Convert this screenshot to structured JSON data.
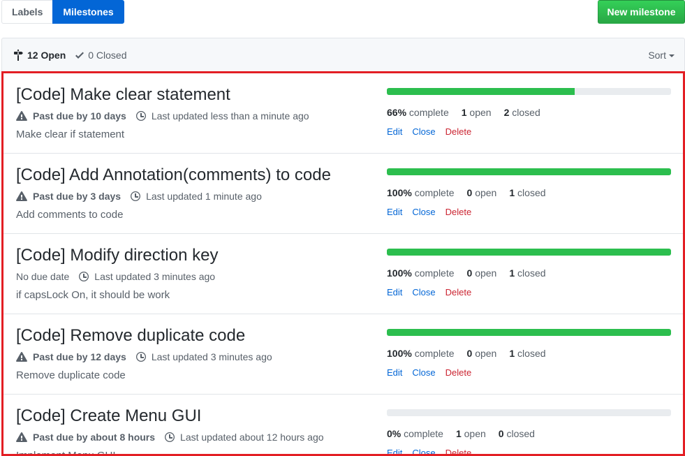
{
  "nav": {
    "labels": "Labels",
    "milestones": "Milestones"
  },
  "new_milestone": "New milestone",
  "header": {
    "open_count": "12 Open",
    "closed_count": "0 Closed",
    "sort": "Sort"
  },
  "colors": {
    "accent": "#0366d6",
    "success": "#2cbe4e",
    "danger": "#cb2431",
    "highlight": "#e31e24"
  },
  "milestones": [
    {
      "title": "[Code] Make clear statement",
      "due": "Past due by 10 days",
      "past_due": true,
      "updated": "Last updated less than a minute ago",
      "description": "Make clear if statement",
      "percent": 66,
      "percent_label": "66%",
      "complete": "complete",
      "open_num": "1",
      "open_label": "open",
      "closed_num": "2",
      "closed_label": "closed"
    },
    {
      "title": "[Code] Add Annotation(comments) to code",
      "due": "Past due by 3 days",
      "past_due": true,
      "updated": "Last updated 1 minute ago",
      "description": "Add comments to code",
      "percent": 100,
      "percent_label": "100%",
      "complete": "complete",
      "open_num": "0",
      "open_label": "open",
      "closed_num": "1",
      "closed_label": "closed"
    },
    {
      "title": "[Code] Modify direction key",
      "due": "No due date",
      "past_due": false,
      "updated": "Last updated 3 minutes ago",
      "description": "if capsLock On, it should be work",
      "percent": 100,
      "percent_label": "100%",
      "complete": "complete",
      "open_num": "0",
      "open_label": "open",
      "closed_num": "1",
      "closed_label": "closed"
    },
    {
      "title": "[Code] Remove duplicate code",
      "due": "Past due by 12 days",
      "past_due": true,
      "updated": "Last updated 3 minutes ago",
      "description": "Remove duplicate code",
      "percent": 100,
      "percent_label": "100%",
      "complete": "complete",
      "open_num": "0",
      "open_label": "open",
      "closed_num": "1",
      "closed_label": "closed"
    },
    {
      "title": "[Code] Create Menu GUI",
      "due": "Past due by about 8 hours",
      "past_due": true,
      "updated": "Last updated about 12 hours ago",
      "description": "Implement Menu GUI",
      "percent": 0,
      "percent_label": "0%",
      "complete": "complete",
      "open_num": "1",
      "open_label": "open",
      "closed_num": "0",
      "closed_label": "closed"
    }
  ],
  "actions": {
    "edit": "Edit",
    "close": "Close",
    "delete": "Delete"
  },
  "icons": {
    "milestone": "milestone-icon",
    "check": "check-icon",
    "alert": "alert-icon",
    "clock": "clock-icon"
  }
}
